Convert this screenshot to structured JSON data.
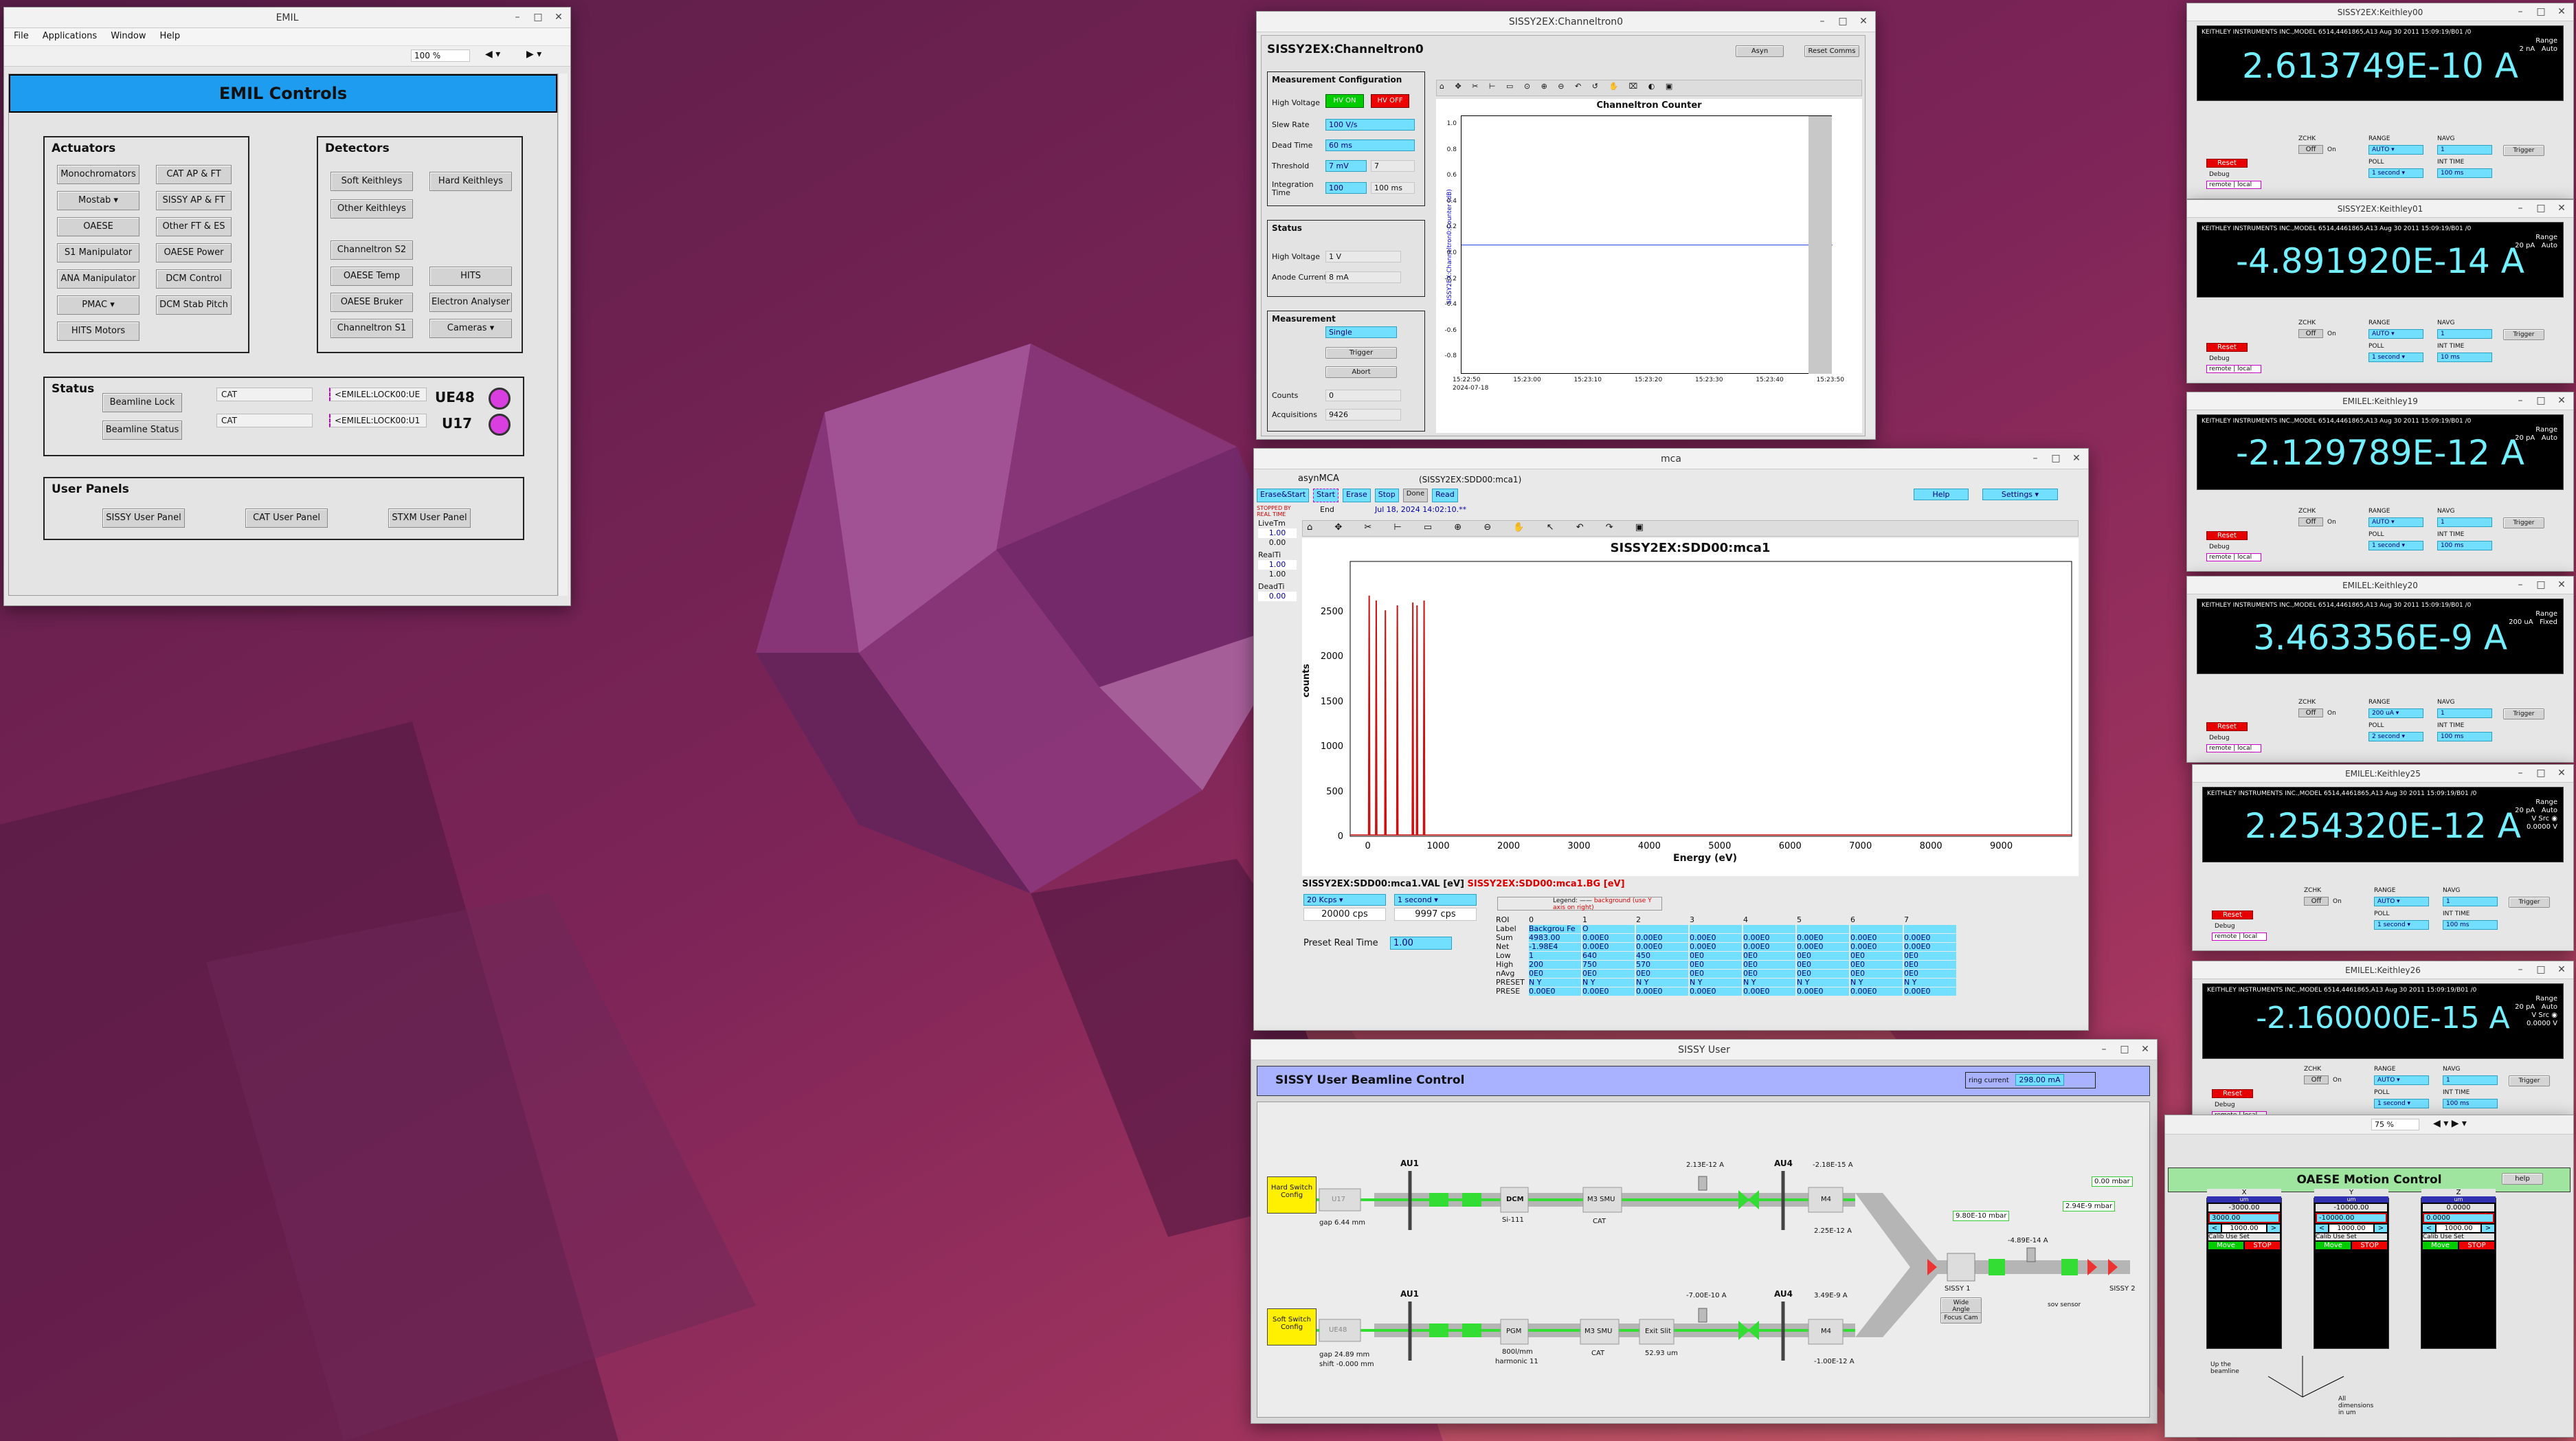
{
  "emil": {
    "title": "EMIL",
    "menu": [
      "File",
      "Applications",
      "Window",
      "Help"
    ],
    "zoom": "100 %",
    "header": "EMIL Controls",
    "actuators": {
      "title": "Actuators",
      "buttons": [
        "Monochromators",
        "CAT AP & FT",
        "Mostab",
        "SISSY AP & FT",
        "OAESE",
        "Other FT & ES",
        "S1 Manipulator",
        "OAESE Power",
        "ANA Manipulator",
        "DCM Control",
        "PMAC",
        "DCM Stab Pitch",
        "HITS Motors"
      ]
    },
    "detectors": {
      "title": "Detectors",
      "buttons": [
        "Soft Keithleys",
        "Hard Keithleys",
        "Other Keithleys",
        "Channeltron S2",
        "OAESE Temp",
        "HITS",
        "OAESE Bruker",
        "Electron Analyser",
        "Channeltron S1",
        "Cameras"
      ]
    },
    "status": {
      "title": "Status",
      "beamline_lock": "Beamline Lock",
      "beamline_status": "Beamline Status",
      "cat1": "CAT",
      "cat2": "CAT",
      "lock1": "<EMILEL:LOCK00:UE",
      "lock2": "<EMILEL:LOCK00:U1",
      "ue48": "UE48",
      "u17": "U17"
    },
    "user_panels": {
      "title": "User Panels",
      "sissy": "SISSY User Panel",
      "cat": "CAT User Panel",
      "stxm": "STXM User Panel"
    }
  },
  "channeltron": {
    "title": "SISSY2EX:Channeltron0",
    "header": "SISSY2EX:Channeltron0",
    "asyn": "Asyn",
    "reset": "Reset Comms",
    "config": {
      "title": "Measurement Configuration",
      "hv": "High Voltage",
      "hv_on": "HV ON",
      "hv_off": "HV OFF",
      "slew": "Slew Rate",
      "slew_v": "100 V/s",
      "dead": "Dead Time",
      "dead_v": "60 ms",
      "thr": "Threshold",
      "thr_v": "7 mV",
      "thr_r": "7",
      "int": "Integration Time",
      "int_v": "100",
      "int_r": "100 ms"
    },
    "status": {
      "title": "Status",
      "hv": "High Voltage",
      "hv_v": "1 V",
      "anode": "Anode Current",
      "anode_v": "8 mA"
    },
    "meas": {
      "title": "Measurement",
      "mode": "Single",
      "trigger": "Trigger",
      "abort": "Abort",
      "counts": "Counts",
      "counts_v": "0",
      "acq": "Acquisitions",
      "acq_v": "9426"
    },
    "plot_title": "Channeltron Counter",
    "ylabel": "SISSY2EX:Channeltron0:Counter (dB)",
    "xticks": [
      "15:22:50",
      "15:23:00",
      "15:23:10",
      "15:23:20",
      "15:23:30",
      "15:23:40",
      "15:23:50"
    ],
    "date": "2024-07-18",
    "yticks": [
      "1.0",
      "0.8",
      "0.6",
      "0.4",
      "0.2",
      "0.0",
      "-0.2",
      "-0.4",
      "-0.6",
      "-0.8",
      "-1.0"
    ]
  },
  "mca": {
    "title": "mca",
    "asyn": "asynMCA",
    "pv": "(SISSY2EX:SDD00:mca1)",
    "erase_start": "Erase&Start",
    "start": "Start",
    "erase": "Erase",
    "stop": "Stop",
    "done": "Done",
    "read": "Read",
    "help": "Help",
    "settings": "Settings",
    "stopped": "STOPPED BY REAL TIME",
    "end": "End",
    "date": "Jul 18, 2024 14:02:10.**",
    "livetm": "LiveTm",
    "lt1": "1.00",
    "lt2": "0.00",
    "realt": "RealTi",
    "rt1": "1.00",
    "rt2": "1.00",
    "deadt": "DeadTi",
    "dt": "0.00",
    "plot_title": "SISSY2EX:SDD00:mca1",
    "xlabel": "Energy (eV)",
    "ylabel": "counts",
    "val_lbl": "SISSY2EX:SDD00:mca1.VAL [eV]",
    "bg_lbl": "SISSY2EX:SDD00:mca1.BG [eV]",
    "kcps": "20 Kcps",
    "poll": "1 second",
    "cps1": "20000 cps",
    "cps2": "9997 cps",
    "preset_lbl": "Preset Real Time",
    "preset_v": "1.00",
    "roi_rows": [
      "ROI",
      "Label",
      "Sum",
      "Net",
      "Low",
      "High",
      "nAvg",
      "PRESET",
      "PRESE"
    ],
    "roi_cols": [
      "0",
      "1",
      "2",
      "3",
      "4",
      "5",
      "6",
      "7"
    ]
  },
  "sissy": {
    "title": "SISSY User",
    "header": "SISSY User Beamline Control",
    "ring_lbl": "ring current",
    "ring_v": "298.00 mA",
    "hard": "Hard Switch Config",
    "soft": "Soft Switch Config",
    "au1": "AU1",
    "au1b": "AU1",
    "au4": "AU4",
    "au4b": "AU4",
    "u17": "U17",
    "ue48": "UE48",
    "gap1": "gap  6.44   mm",
    "gap2": "gap   24.89   mm",
    "shift": "shift  -0.000   mm",
    "dcm": "DCM",
    "si111": "Si-111",
    "pgm": "PGM",
    "lines": "800l/mm",
    "harm": "harmonic  11",
    "m3": "M3 SMU",
    "m3b": "M3 SMU",
    "cat": "CAT",
    "catb": "CAT",
    "exit": "Exit Slit",
    "exitv": "52.93 um",
    "m4": "M4",
    "m4b": "M4",
    "sissy1": "SISSY 1",
    "sissy2": "SISSY 2",
    "wide": "Wide Angle",
    "focus": "Focus Cam",
    "sov": "sov sensor",
    "r1": "2.13E-12 A",
    "r2": "-2.18E-15 A",
    "r3": "2.25E-12 A",
    "r4": "-7.00E-10 A",
    "r5": "3.49E-9 A",
    "r6": "-1.00E-12 A",
    "p1": "9.80E-10 mbar",
    "p2": "-4.89E-14 A",
    "p3": "0.00 mbar",
    "p4": "2.94E-9 mbar"
  },
  "k00": {
    "title": "SISSY2EX:Keithley00",
    "value": "2.613749E-10 A",
    "range": "Range",
    "range_v": "2 nA",
    "mode": "Auto"
  },
  "k01": {
    "title": "SISSY2EX:Keithley01",
    "value": "-4.891920E-14 A",
    "range": "Range",
    "range_v": "20 pA",
    "mode": "Auto"
  },
  "k19": {
    "title": "EMILEL:Keithley19",
    "value": "-2.129789E-12 A",
    "range": "Range",
    "range_v": "20 pA",
    "mode": "Auto"
  },
  "k20": {
    "title": "EMILEL:Keithley20",
    "value": "3.463356E-9 A",
    "range": "Range",
    "range_v": "200 uA",
    "mode": "Fixed"
  },
  "k25": {
    "title": "EMILEL:Keithley25",
    "value": "2.254320E-12 A",
    "range": "Range",
    "range_v": "20 pA",
    "mode": "Auto",
    "vsrc": "V Src",
    "vsrc_v": "0.0000 V"
  },
  "k26": {
    "title": "EMILEL:Keithley26",
    "value": "-2.160000E-15 A",
    "range": "Range",
    "range_v": "20 pA",
    "mode": "Auto",
    "vsrc": "V Src",
    "vsrc_v": "0.0000 V"
  },
  "kshared": {
    "zchk": "ZCHK",
    "off": "Off",
    "on": "On",
    "range": "RANGE",
    "auto": "AUTO",
    "navg": "NAVG",
    "navg_v": "1",
    "trigger": "Trigger",
    "reset": "Reset",
    "debug": "Debug",
    "poll": "POLL",
    "poll_v": "1 second",
    "int": "INT TIME",
    "int_v": "100 ms",
    "remote": "remote",
    "local": "local",
    "head": "KEITHLEY INSTRUMENTS INC.,MODEL 6514,4461865,A13   Aug 30 2011 15:09:19/B01  /0"
  },
  "oaese": {
    "title": "OAESE Motion Control",
    "zoom": "75 %",
    "help": "help",
    "axes": [
      {
        "name": "X",
        "v1": "-3000.00",
        "v2": "3000.00",
        "step": "1000.00"
      },
      {
        "name": "Y",
        "v1": "-10000.00",
        "v2": "-10000.00",
        "step": "1000.00"
      },
      {
        "name": "Z",
        "v1": "0.0000",
        "v2": "0.0000",
        "step": "1000.00"
      }
    ],
    "calib": "Calib",
    "use": "Use",
    "set": "Set",
    "move": "Move",
    "stop": "STOP",
    "upbeam": "Up the beamline",
    "dims": "All dimensions in um"
  }
}
